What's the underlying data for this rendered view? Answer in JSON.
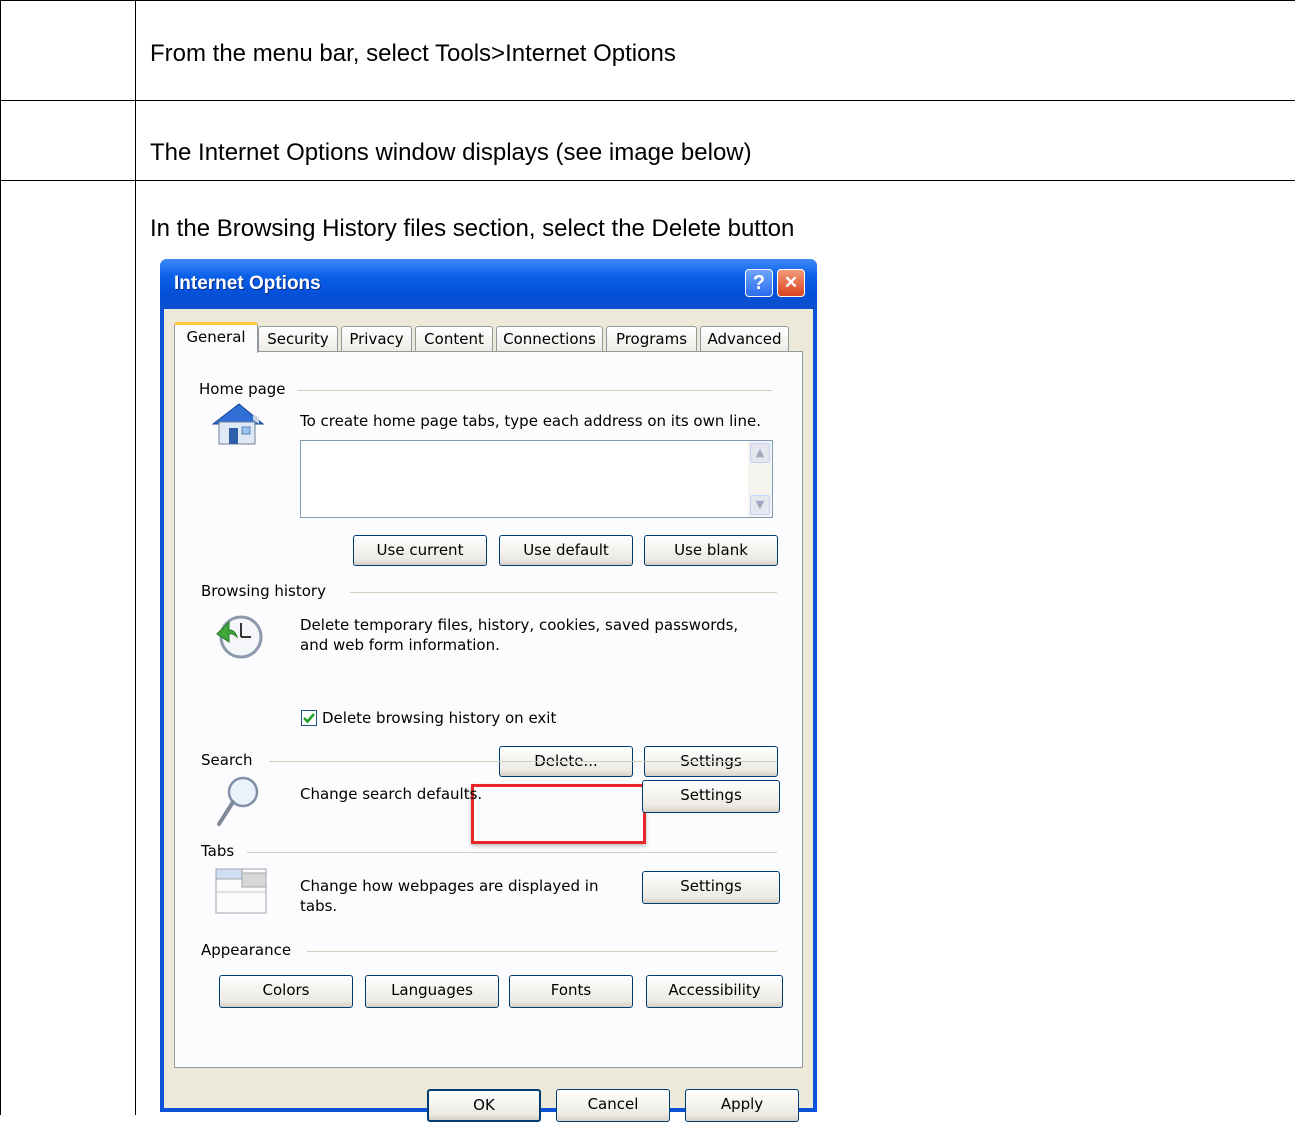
{
  "steps": [
    {
      "text": "From the menu bar, select Tools>Internet Options"
    },
    {
      "text": "The Internet Options window displays (see image below)"
    },
    {
      "text": "In the Browsing History files section, select the Delete button"
    }
  ],
  "dialog": {
    "title": "Internet Options",
    "help_label": "?",
    "close_label": "✕",
    "tabs": [
      "General",
      "Security",
      "Privacy",
      "Content",
      "Connections",
      "Programs",
      "Advanced"
    ],
    "active_tab": "General",
    "home_page": {
      "group_label": "Home page",
      "instruction": "To create home page tabs, type each address on its own line.",
      "textarea_value": "",
      "buttons": {
        "use_current": "Use current",
        "use_default": "Use default",
        "use_blank": "Use blank"
      }
    },
    "browsing_history": {
      "group_label": "Browsing history",
      "description_line1": "Delete temporary files, history, cookies, saved passwords,",
      "description_line2": "and web form information.",
      "checkbox_label": "Delete browsing history on exit",
      "checkbox_checked": true,
      "delete_button": "Delete...",
      "settings_button": "Settings"
    },
    "search": {
      "group_label": "Search",
      "description": "Change search defaults.",
      "settings_button": "Settings"
    },
    "tabs_section": {
      "group_label": "Tabs",
      "description_line1": "Change how webpages are displayed in",
      "description_line2": "tabs.",
      "settings_button": "Settings"
    },
    "appearance": {
      "group_label": "Appearance",
      "buttons": {
        "colors": "Colors",
        "languages": "Languages",
        "fonts": "Fonts",
        "accessibility": "Accessibility"
      }
    },
    "footer": {
      "ok": "OK",
      "cancel": "Cancel",
      "apply": "Apply"
    },
    "colors": {
      "titlebar": "#0a5fe8",
      "highlight": "#e8262a",
      "tab_active_accent": "#ffc73c"
    }
  }
}
